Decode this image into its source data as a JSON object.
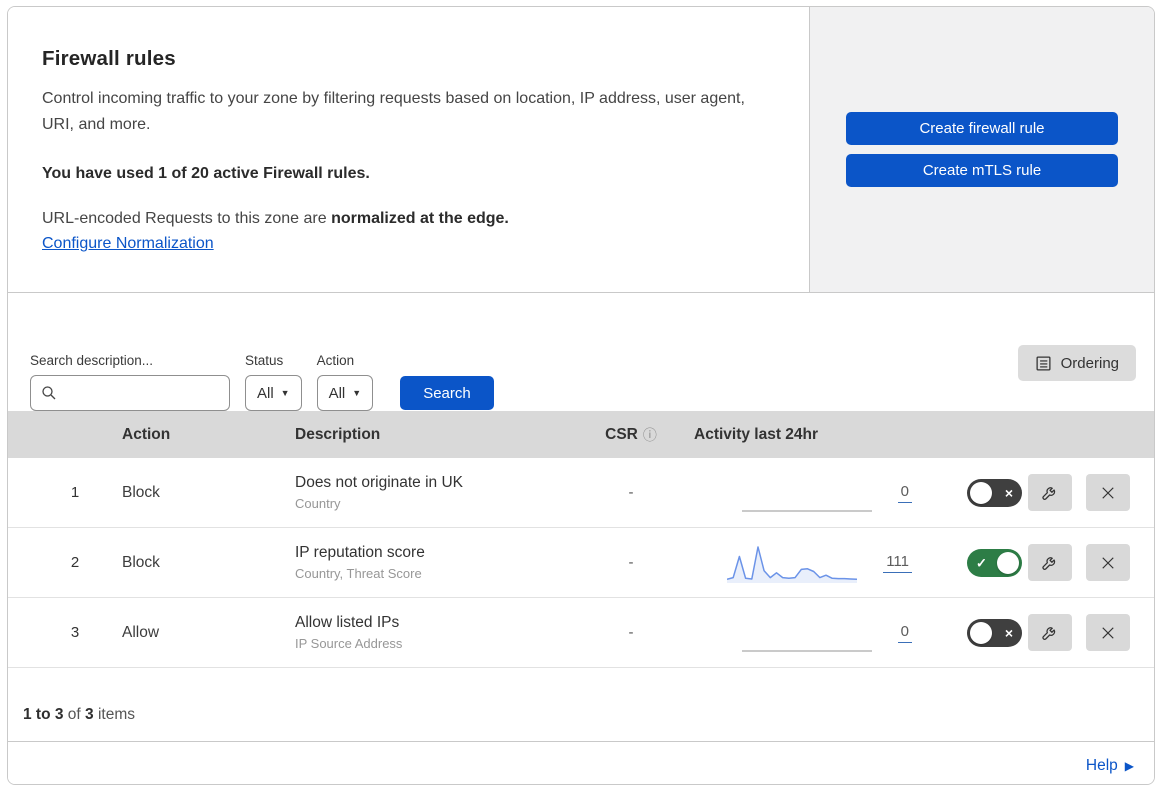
{
  "intro": {
    "title": "Firewall rules",
    "description": "Control incoming traffic to your zone by filtering requests based on location, IP address, user agent, URI, and more.",
    "usage_bold": "You have used 1 of 20 active Firewall rules.",
    "normalization_text": "URL-encoded Requests to this zone are ",
    "normalization_bold": "normalized at the edge.",
    "normalization_link": "Configure Normalization"
  },
  "actions_panel": {
    "create_firewall_label": "Create firewall rule",
    "create_mtls_label": "Create mTLS rule"
  },
  "filters": {
    "search_label": "Search description...",
    "search_value": "",
    "status_label": "Status",
    "status_value": "All",
    "action_label": "Action",
    "action_value": "All",
    "search_button": "Search",
    "ordering_button": "Ordering"
  },
  "table": {
    "header": {
      "action": "Action",
      "description": "Description",
      "csr": "CSR",
      "activity": "Activity last 24hr"
    },
    "rows": [
      {
        "priority": "1",
        "action": "Block",
        "description": "Does not originate in UK",
        "fields": "Country",
        "csr": "-",
        "activity_count": "0",
        "activity_spark": [
          0,
          0
        ],
        "enabled": false
      },
      {
        "priority": "2",
        "action": "Block",
        "description": "IP reputation score",
        "fields": "Country, Threat Score",
        "csr": "-",
        "activity_count": "111",
        "activity_spark": [
          5,
          10,
          72,
          8,
          6,
          100,
          30,
          10,
          24,
          10,
          8,
          10,
          34,
          36,
          28,
          10,
          17,
          8,
          7,
          7,
          6,
          5
        ],
        "enabled": true
      },
      {
        "priority": "3",
        "action": "Allow",
        "description": "Allow listed IPs",
        "fields": "IP Source Address",
        "csr": "-",
        "activity_count": "0",
        "activity_spark": [
          0,
          0
        ],
        "enabled": false
      }
    ]
  },
  "footer": {
    "range": "1 to 3",
    "of": " of ",
    "total": "3",
    "items": " items",
    "help": "Help"
  },
  "glyphs": {
    "info": "ⓘ",
    "dropdown": "▼",
    "help_arrow": "▶",
    "toggle_cross": "×",
    "toggle_check": "✓"
  },
  "icons": [
    "search-icon",
    "ordering-list-icon",
    "info-icon",
    "wrench-icon",
    "delete-x-icon",
    "dropdown-arrow-icon",
    "help-arrow-icon"
  ],
  "colors": {
    "accent_blue": "#0b55c8",
    "toggle_on_green": "#2d7d46",
    "toggle_off_gray": "#3f3f3f",
    "sparkline_blue": "#6b93e8",
    "table_header_gray": "#d9d9d9",
    "side_panel_gray": "#f1f1f2"
  }
}
